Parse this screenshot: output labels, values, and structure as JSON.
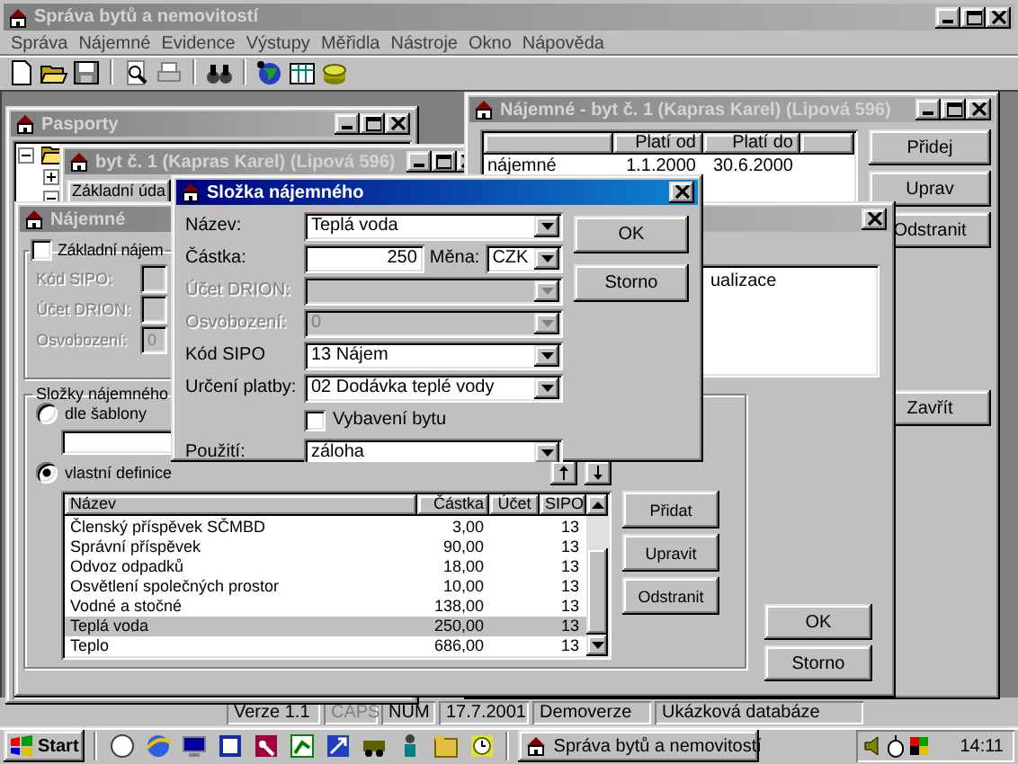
{
  "app": {
    "title": "Správa bytů a nemovitostí"
  },
  "menu": [
    {
      "label": "Správa"
    },
    {
      "label": "Nájemné"
    },
    {
      "label": "Evidence"
    },
    {
      "label": "Výstupy"
    },
    {
      "label": "Měřidla"
    },
    {
      "label": "Nástroje"
    },
    {
      "label": "Okno"
    },
    {
      "label": "Nápověda"
    }
  ],
  "pasporty": {
    "title": "Pasporty",
    "tree": [
      {
        "expanded": true,
        "children": [
          {
            "expanded": false
          },
          {
            "expanded": true
          }
        ]
      }
    ]
  },
  "byt_window": {
    "title": "byt č. 1 (Kapras Karel) (Lipová 596)",
    "tabs": [
      {
        "label": "Základní úda",
        "selected": true
      }
    ]
  },
  "rent_list_window": {
    "title": "Nájemné - byt č. 1 (Kapras Karel) (Lipová 596)",
    "columns": [
      {
        "label": "Platí od"
      },
      {
        "label": "Platí do"
      }
    ],
    "rows": [
      {
        "name": "nájemné",
        "from": "1.1.2000",
        "to": "30.6.2000"
      }
    ],
    "buttons": [
      {
        "label": "Přidej"
      },
      {
        "label": "Uprav"
      },
      {
        "label": "Odstranit"
      },
      {
        "label": "Zavřít"
      }
    ]
  },
  "rent_dialog": {
    "title": "Nájemné",
    "basic": {
      "label": "Základní nájem",
      "checked": false,
      "fields": [
        {
          "label": "Kód SIPO:",
          "disabled": true
        },
        {
          "label": "Účet DRION:",
          "disabled": true
        },
        {
          "label": "Osvobození:",
          "value": "0",
          "disabled": true
        }
      ]
    },
    "components": {
      "label": "Složky nájemného",
      "options": [
        {
          "label": "dle šablony",
          "selected": false
        },
        {
          "label": "vlastní definice",
          "selected": true
        }
      ],
      "table": {
        "columns": [
          "Název",
          "Částka",
          "Účet",
          "SIPO"
        ],
        "rows": [
          {
            "name": "Členský příspěvek SČMBD",
            "amount": "3,00",
            "sipo": "13",
            "selected": false
          },
          {
            "name": "Správní příspěvek",
            "amount": "90,00",
            "sipo": "13",
            "selected": false
          },
          {
            "name": "Odvoz odpadků",
            "amount": "18,00",
            "sipo": "13",
            "selected": false
          },
          {
            "name": "Osvětlení společných prostor",
            "amount": "10,00",
            "sipo": "13",
            "selected": false
          },
          {
            "name": "Vodné a stočné",
            "amount": "138,00",
            "sipo": "13",
            "selected": false
          },
          {
            "name": "Teplá voda",
            "amount": "250,00",
            "sipo": "13",
            "selected": true
          },
          {
            "name": "Teplo",
            "amount": "686,00",
            "sipo": "13",
            "selected": false
          }
        ]
      },
      "buttons": [
        {
          "label": "Přidat"
        },
        {
          "label": "Upravit"
        },
        {
          "label": "Odstranit"
        }
      ]
    },
    "note": "ualizace",
    "buttons": [
      {
        "label": "OK"
      },
      {
        "label": "Storno"
      }
    ]
  },
  "component_dialog": {
    "title": "Složka nájemného",
    "fields": [
      {
        "kind": "combo",
        "label": "Název:",
        "value": "Teplá voda",
        "disabled": false
      },
      {
        "kind": "amount",
        "label": "Částka:",
        "value": "250",
        "currency_label": "Měna:",
        "currency": "CZK",
        "disabled": false
      },
      {
        "kind": "combo",
        "label": "Účet DRION:",
        "disabled": true
      },
      {
        "kind": "combo",
        "label": "Osvobození:",
        "value": "0",
        "disabled": true
      },
      {
        "kind": "combo",
        "label": "Kód SIPO",
        "value": "13 Nájem",
        "disabled": false
      },
      {
        "kind": "combo",
        "label": "Určení platby:",
        "value": "02 Dodávka teplé vody",
        "disabled": false
      },
      {
        "kind": "check",
        "label": "Vybavení bytu",
        "checked": false,
        "disabled": false
      },
      {
        "kind": "combo",
        "label": "Použití:",
        "value": "záloha",
        "disabled": false
      }
    ],
    "buttons": [
      {
        "label": "OK"
      },
      {
        "label": "Storno"
      }
    ]
  },
  "status_bar": [
    {
      "text": "Verze 1.1",
      "disabled": false
    },
    {
      "text": "CAPS",
      "disabled": true
    },
    {
      "text": "NUM",
      "disabled": false
    },
    {
      "text": "17.7.2001",
      "disabled": false
    },
    {
      "text": "Demoverze",
      "disabled": false
    },
    {
      "text": "Ukázková databáze",
      "disabled": false
    }
  ],
  "taskbar": {
    "start": "Start",
    "tasks": [
      {
        "label": "Správa bytů a nemovitostí",
        "selected": false
      }
    ],
    "clock": "14:11"
  }
}
